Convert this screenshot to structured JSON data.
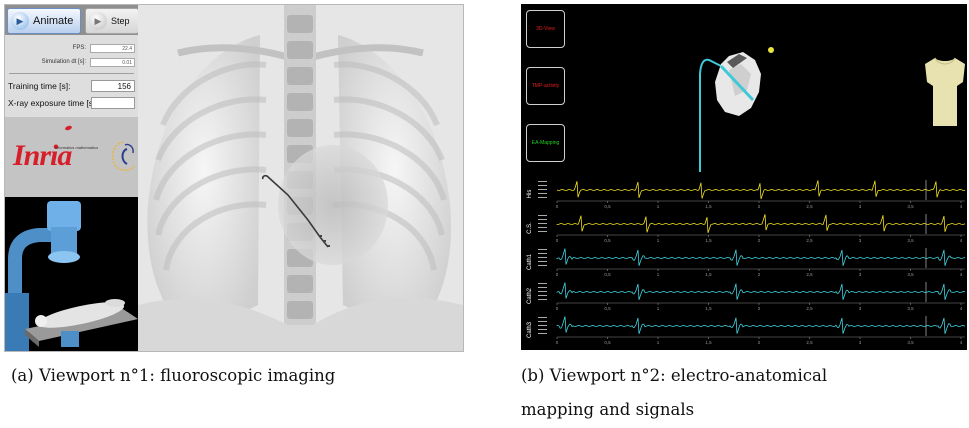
{
  "viewport1": {
    "toolbar": {
      "animate_label": "Animate",
      "step_label": "Step"
    },
    "fields": [
      {
        "label": "FPS:",
        "value": "22.4"
      },
      {
        "label": "Simulation dt [s]:",
        "value": "0.01"
      }
    ],
    "training_time": {
      "label": "Training time [s]:",
      "value": "156"
    },
    "xray_exposure": {
      "label": "X-ray exposure time [s]:",
      "value": ""
    },
    "logo": {
      "text": "Inria",
      "subtitle": "informatics mathematics"
    },
    "icons": [
      "play-icon",
      "play-icon",
      "inria-logo",
      "lab-seal-icon",
      "c-arm-scene",
      "fluoroscopic-image"
    ]
  },
  "viewport2": {
    "buttons": [
      {
        "label": "3D-View",
        "color": "#e02020"
      },
      {
        "label": "TMP-activity",
        "color": "#e02020"
      },
      {
        "label": "EA-Mapping",
        "color": "#22d022"
      }
    ],
    "channels": [
      {
        "name": "His",
        "color": "#f0e020"
      },
      {
        "name": "C.S.",
        "color": "#f0e020"
      },
      {
        "name": "Cath1",
        "color": "#3fd3e0"
      },
      {
        "name": "Cath2",
        "color": "#3fd3e0"
      },
      {
        "name": "Cath3",
        "color": "#3fd3e0"
      }
    ],
    "time_ticks": [
      "0",
      "0,5",
      "1",
      "1,5",
      "2",
      "2,5",
      "3",
      "3,5",
      "4"
    ]
  },
  "captions": {
    "a": "(a) Viewport n°1: fluoroscopic imaging",
    "b_line1": "(b) Viewport n°2: electro-anatomical",
    "b_line2": "mapping and signals"
  }
}
